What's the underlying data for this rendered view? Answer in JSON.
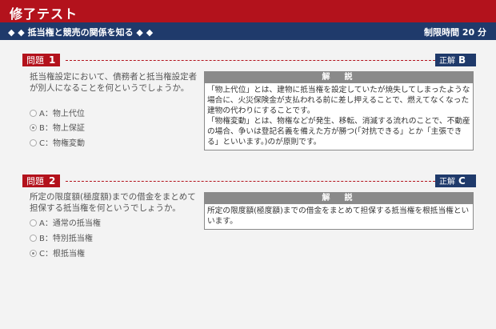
{
  "header": {
    "title": "修了テスト"
  },
  "subheader": {
    "topic": "◆ ◆ 抵当権と競売の関係を知る ◆ ◆",
    "time_limit": "制限時間 20 分"
  },
  "questions": [
    {
      "label": "問題",
      "number": "1",
      "answer_label": "正解",
      "answer": "B",
      "text": "抵当権設定において、債務者と抵当権設定者が別人になることを何というでしょうか。",
      "options": [
        "A：物上代位",
        "B：物上保証",
        "C：物権変動"
      ],
      "selected_index": 1,
      "explanation_title": "解　説",
      "explanation": [
        "「物上代位」とは、建物に抵当権を設定していたが焼失してしまったような場合に、火災保険金が支払われる前に差し押えることで、燃えてなくなった建物の代わりにすることです。",
        "「物権変動」とは、物権などが発生、移転、消滅する流れのことで、不動産の場合、争いは登記名義を備えた方が勝つ(「対抗できる」とか「主張できる」といいます。)のが原則です。"
      ]
    },
    {
      "label": "問題",
      "number": "2",
      "answer_label": "正解",
      "answer": "C",
      "text": "所定の限度額(極度額)までの借金をまとめて担保する抵当権を何というでしょうか。",
      "options": [
        "A：通常の抵当権",
        "B：特別抵当権",
        "C：根抵当権"
      ],
      "selected_index": 2,
      "explanation_title": "解　説",
      "explanation": [
        "所定の限度額(極度額)までの借金をまとめて担保する抵当権を根抵当権といいます。"
      ]
    }
  ]
}
